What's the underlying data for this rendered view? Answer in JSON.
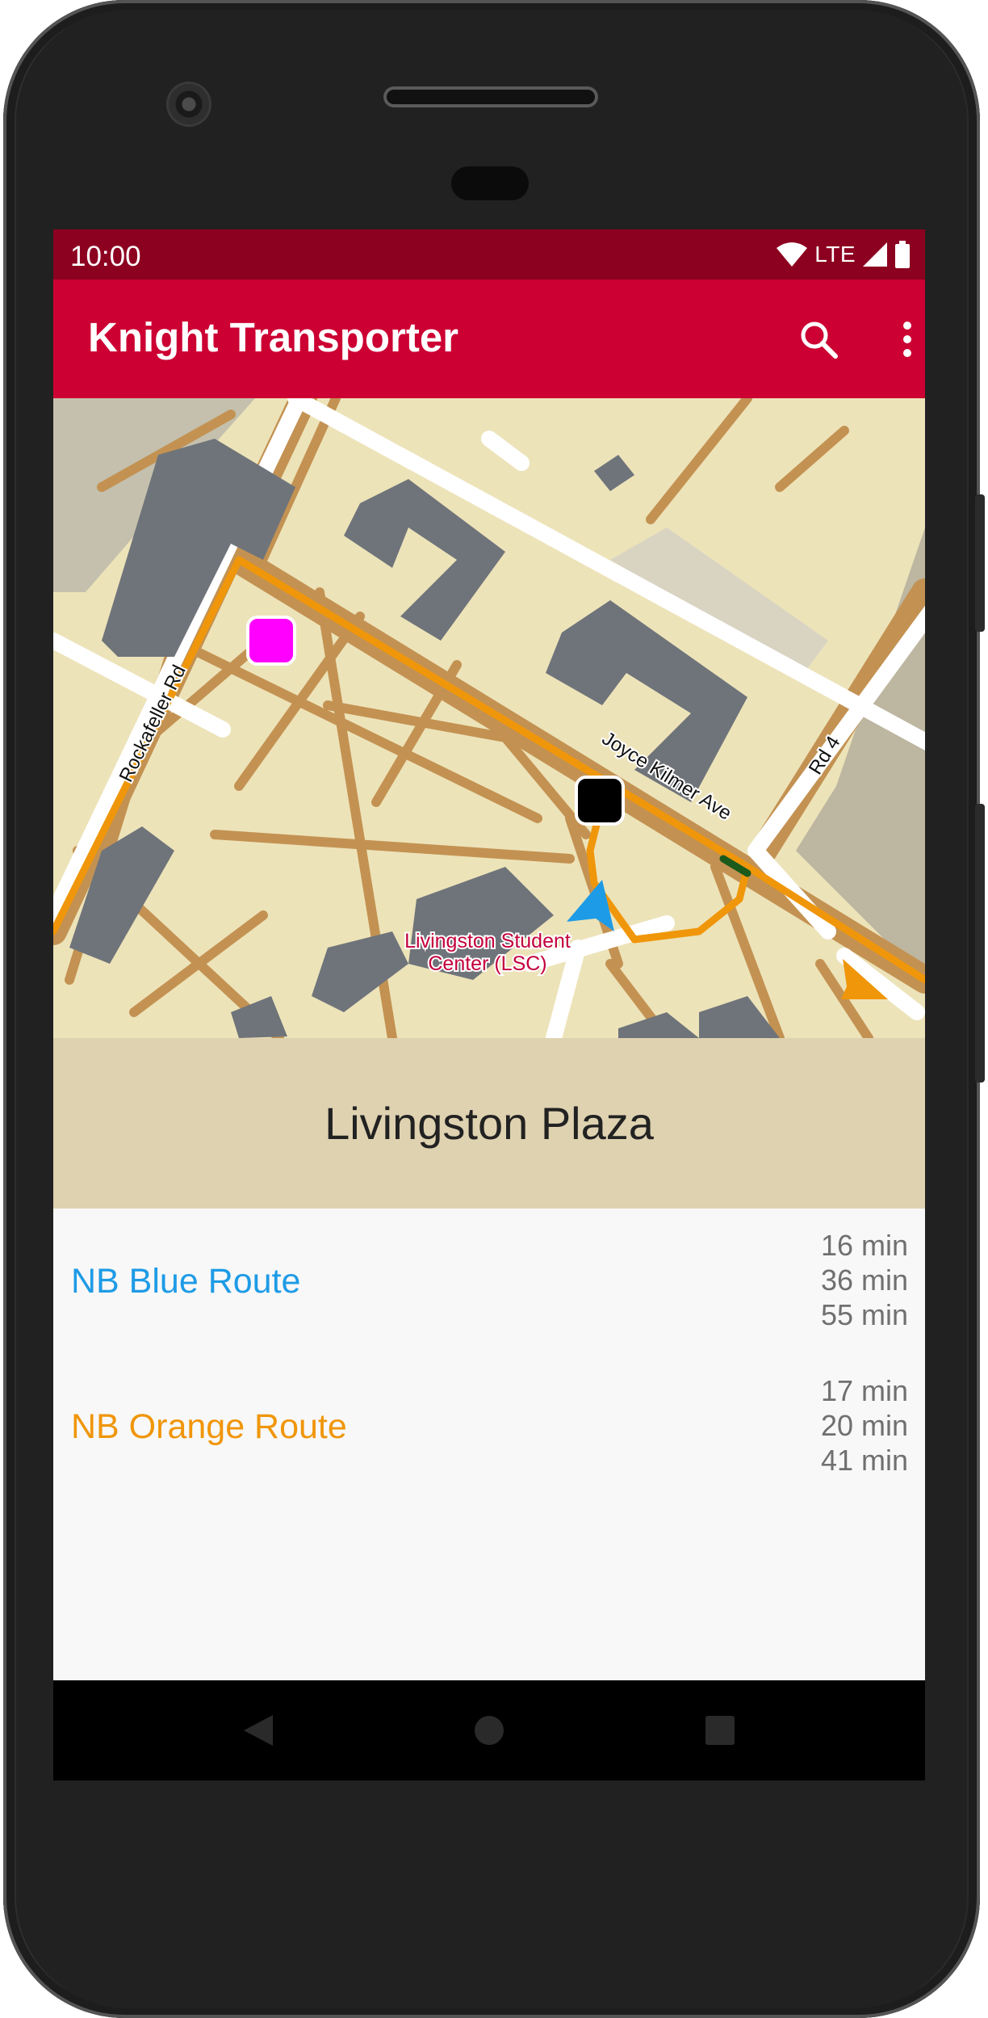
{
  "status_bar": {
    "time": "10:00",
    "network": "LTE",
    "icons": [
      "wifi-icon",
      "cell-signal-icon",
      "battery-icon"
    ]
  },
  "app_bar": {
    "title": "Knight Transporter",
    "actions": [
      "search-icon",
      "overflow-menu-icon"
    ],
    "color": "#cc0033"
  },
  "map": {
    "labels": {
      "street_rockafeller": "Rockafeller Rd",
      "street_joyce_kilmer": "Joyce Kilmer Ave",
      "street_rd4": "Rd 4",
      "poi_line1": "Livingston Student",
      "poi_line2": "Center (LSC)"
    },
    "markers": [
      "magenta-stop-marker",
      "selected-stop-marker",
      "blue-bus-arrow-icon",
      "orange-bus-arrow-icon"
    ]
  },
  "stop": {
    "name": "Livingston Plaza"
  },
  "routes": [
    {
      "name": "NB Blue Route",
      "color": "#1e9be6",
      "times": [
        "16 min",
        "36 min",
        "55 min"
      ]
    },
    {
      "name": "NB Orange Route",
      "color": "#f0960a",
      "times": [
        "17 min",
        "20 min",
        "41 min"
      ]
    }
  ],
  "nav_bar": {
    "buttons": [
      "back-icon",
      "home-icon",
      "recents-icon"
    ]
  }
}
